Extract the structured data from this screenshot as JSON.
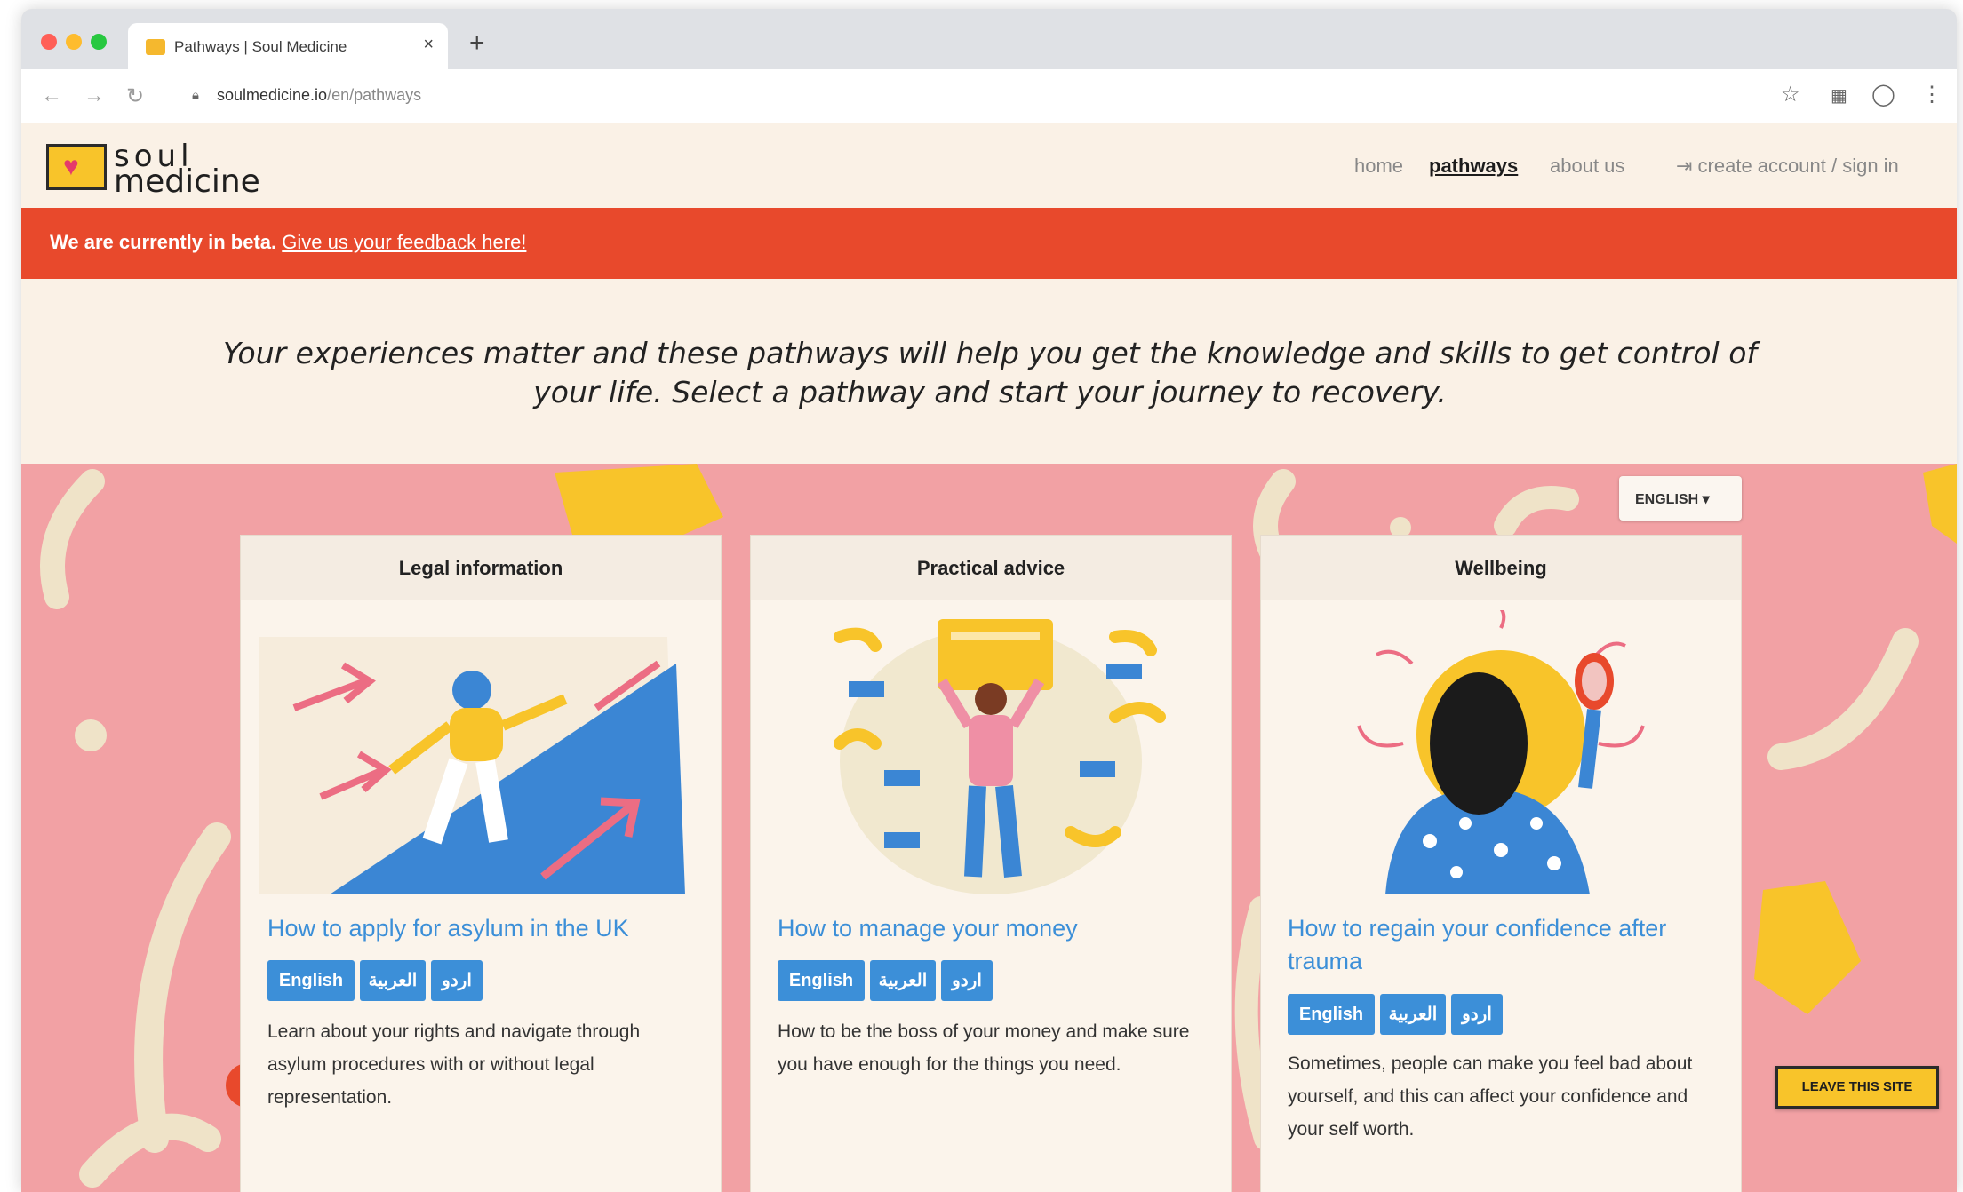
{
  "browser": {
    "tab_title": "Pathways | Soul Medicine",
    "tab_close": "×",
    "new_tab": "+",
    "url_host": "soulmedicine.io",
    "url_path": "/en/pathways"
  },
  "site": {
    "logo_line1": "soul",
    "logo_line2": "medicine",
    "nav": {
      "home": "home",
      "pathways": "pathways",
      "about": "about us",
      "account": "create account / sign in"
    }
  },
  "beta": {
    "text": "We are currently in beta.",
    "link": "Give us your feedback here!"
  },
  "intro": "Your experiences matter and these pathways will help you get the knowledge and skills to get control of your life. Select a pathway and start your journey to recovery.",
  "language_dropdown": "ENGLISH",
  "cards": [
    {
      "category": "Legal information",
      "title": "How to apply for asylum in the UK",
      "langs": [
        "English",
        "العربية",
        "اردو"
      ],
      "description": "Learn about your rights and navigate through asylum procedures with or without legal representation."
    },
    {
      "category": "Practical advice",
      "title": "How to manage your money",
      "langs": [
        "English",
        "العربية",
        "اردو"
      ],
      "description": "How to be the boss of your money and make sure you have enough for the things you need."
    },
    {
      "category": "Wellbeing",
      "title": "How to regain your confidence after trauma",
      "langs": [
        "English",
        "العربية",
        "اردو"
      ],
      "description": "Sometimes, people can make you feel bad about yourself, and this can affect your confidence and your self worth."
    }
  ],
  "leave_site": "LEAVE THIS SITE",
  "colors": {
    "beta_banner": "#e8492c",
    "background_pink": "#f2a1a4",
    "cream": "#faf1e6",
    "link_blue": "#3c8fd8",
    "yellow": "#f8c42a"
  },
  "icons": [
    "back-icon",
    "forward-icon",
    "reload-icon",
    "lock-icon",
    "star-icon",
    "extension-icon",
    "profile-icon",
    "menu-icon",
    "sign-in-icon",
    "heart-icon",
    "caret-down-icon"
  ]
}
